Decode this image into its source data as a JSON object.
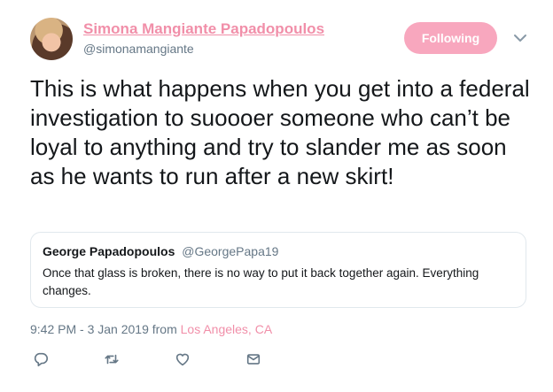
{
  "author": {
    "display_name": "Simona Mangiante Papadopoulos",
    "handle": "@simonamangiante",
    "follow_label": "Following"
  },
  "tweet": {
    "text": "This is what happens when you get into a federal investigation to suoooer someone who can’t be loyal to anything and try to slander me as soon as he wants to run after a new skirt!",
    "time": "9:42 PM - 3 Jan 2019 from ",
    "location": "Los Angeles, CA"
  },
  "quoted_tweet": {
    "name": "George Papadopoulos",
    "handle": "@GeorgePapa19",
    "text": "Once that glass is broken, there is no way to put it back together again. Everything changes."
  },
  "colors": {
    "accent": "#f18fa9",
    "follow_button": "#f8a7be",
    "muted": "#657786"
  },
  "icons": [
    "caret-down-icon",
    "reply-icon",
    "retweet-icon",
    "like-icon",
    "message-icon"
  ]
}
